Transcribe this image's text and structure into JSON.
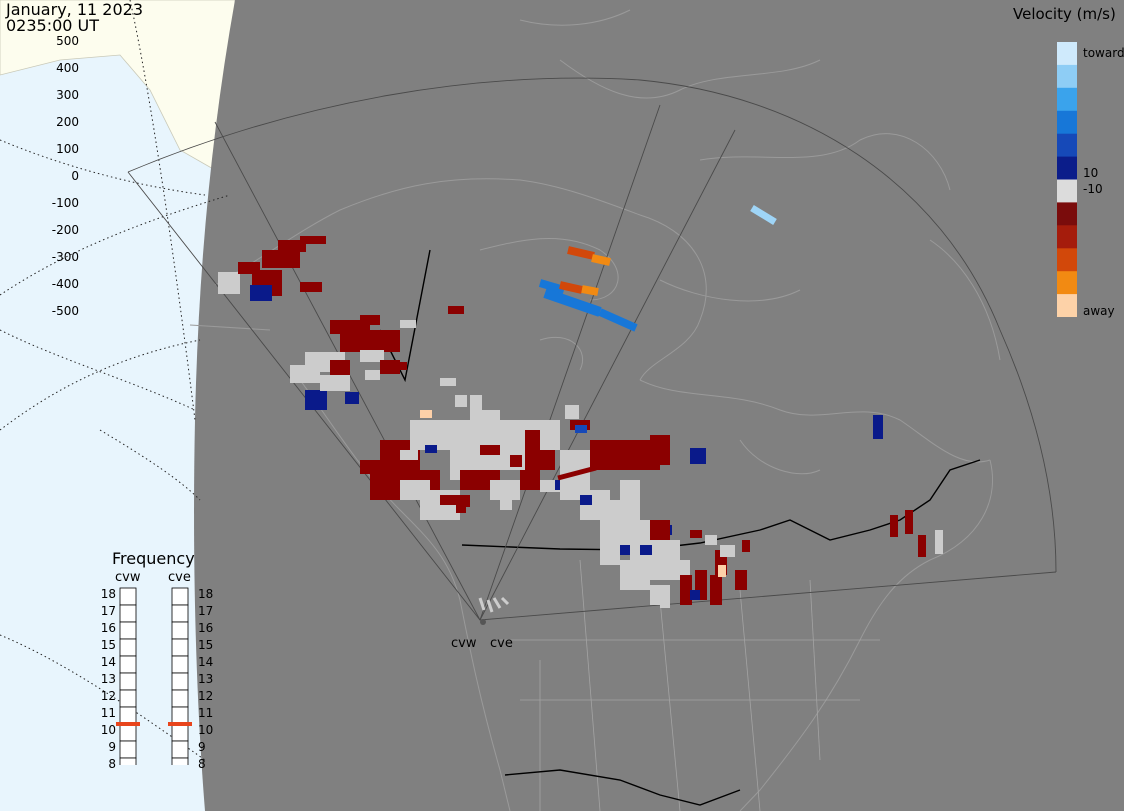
{
  "header": {
    "date": "January, 11 2023",
    "time": "0235:00 UT"
  },
  "colorbar": {
    "title": "Velocity (m/s)",
    "ticks": [
      "500",
      "400",
      "300",
      "200",
      "100",
      "0",
      "-100",
      "-200",
      "-300",
      "-400",
      "-500"
    ],
    "toward_label": "toward",
    "away_label": "away",
    "small_pos": "10",
    "small_neg": "-10",
    "colors": [
      "#cfeafc",
      "#8ecdf5",
      "#3aa3ec",
      "#1777d8",
      "#1649b8",
      "#0b1d8a",
      "#dcdcdc",
      "#7a0c0c",
      "#a51c0c",
      "#d2480a",
      "#f28a12",
      "#fdd2a8"
    ]
  },
  "frequency": {
    "title": "Frequency",
    "radars": [
      {
        "name": "cvw",
        "freq": 11
      },
      {
        "name": "cve",
        "freq": 11
      }
    ],
    "levels": [
      "18",
      "17",
      "16",
      "15",
      "14",
      "13",
      "12",
      "11",
      "10",
      "9",
      "8"
    ],
    "marker_color": "#e8451c"
  },
  "sites": {
    "west": "cvw",
    "east": "cve"
  },
  "map": {
    "ocean_color": "#e8f5fd",
    "land_color": "#fdfdee",
    "night_color": "#808080",
    "outline_color": "#9a9a9a",
    "border_color": "#000000"
  },
  "legend_colors": {
    "toward": "#9fd5f7",
    "away": "#fdd0a8",
    "ground_scatter": "#cccccc",
    "neg_dark": "#8b0000",
    "pos_dark": "#0a1a8a"
  }
}
